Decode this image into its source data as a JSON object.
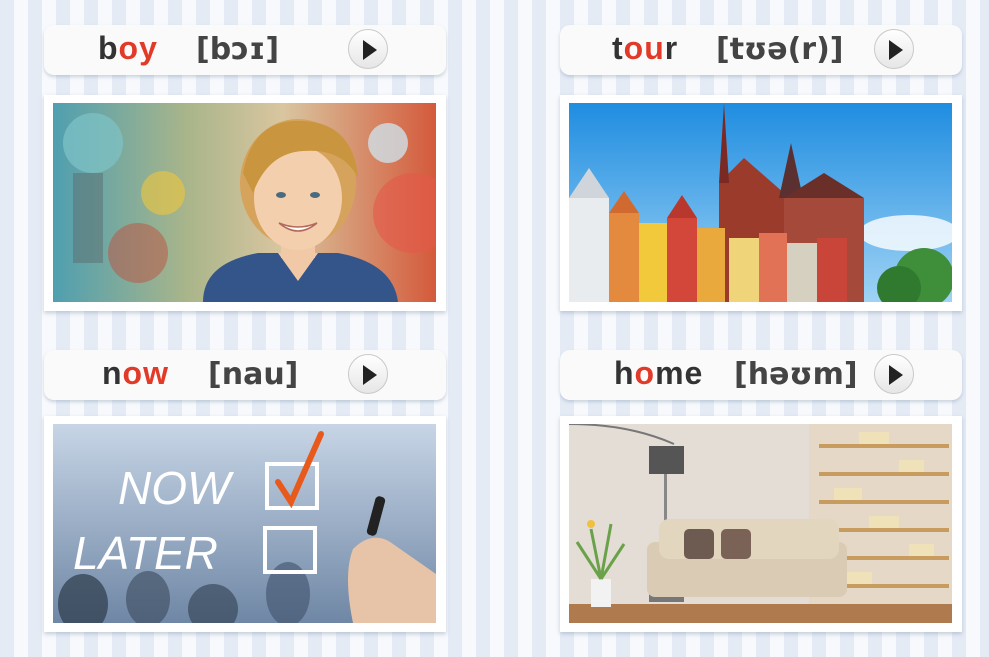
{
  "cards": [
    {
      "word_parts": [
        "b",
        "oy",
        ""
      ],
      "ipa": "[bɔɪ]",
      "image": "boy-photo"
    },
    {
      "word_parts": [
        "t",
        "ou",
        "r"
      ],
      "ipa": "[tʊə(r)]",
      "image": "tour-photo"
    },
    {
      "word_parts": [
        "n",
        "ow",
        ""
      ],
      "ipa": "[nau]",
      "image": "now-later-photo"
    },
    {
      "word_parts": [
        "h",
        "o",
        "me"
      ],
      "ipa": "[həʊm]",
      "image": "home-photo"
    }
  ],
  "now_later": {
    "now": "NOW",
    "later": "LATER"
  },
  "colors": {
    "highlight": "#e23a28",
    "text": "#333333",
    "stripe": "#e4ebf5"
  },
  "icons": {
    "play": "play-icon"
  }
}
